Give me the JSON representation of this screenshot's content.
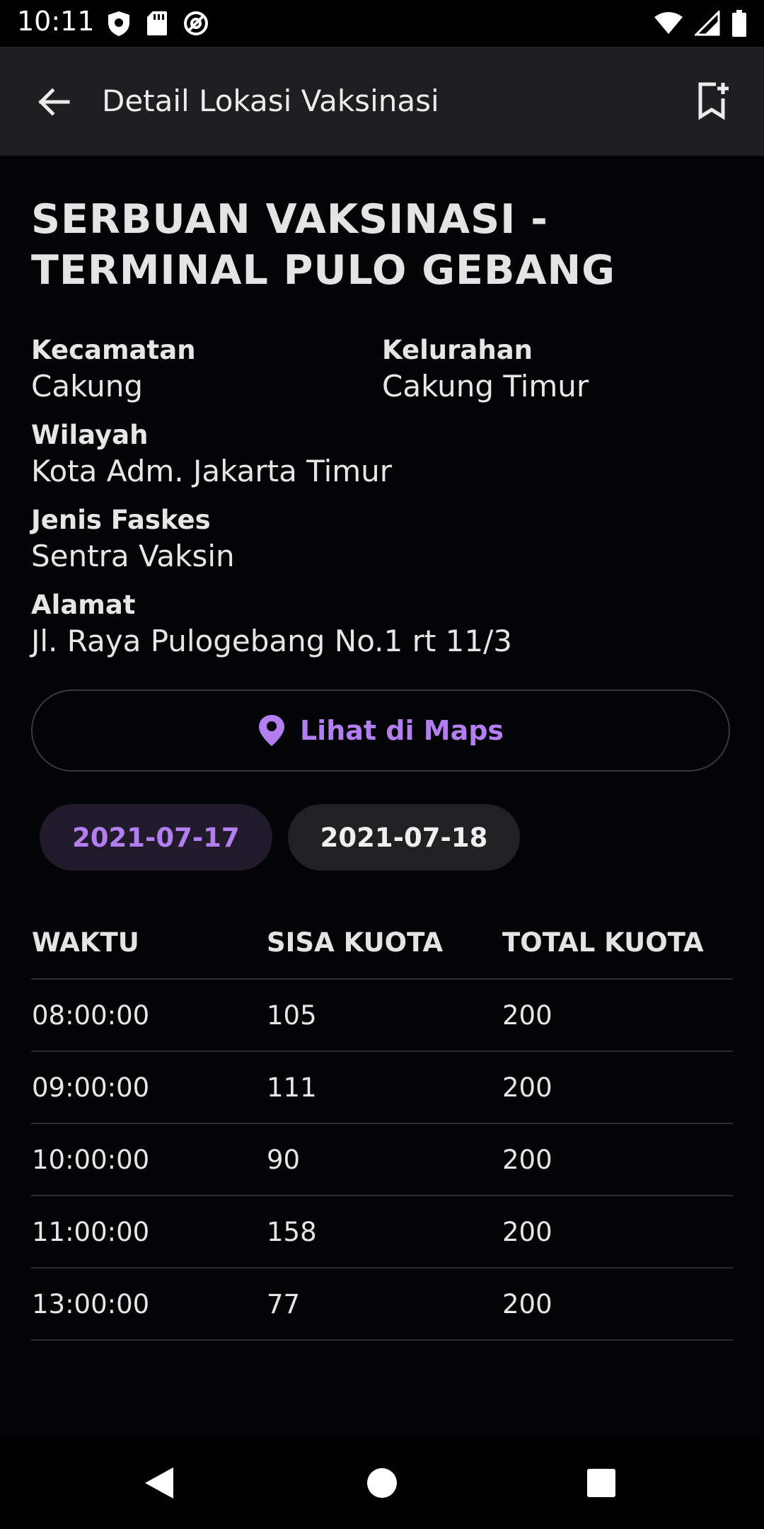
{
  "status_bar": {
    "time": "10:11",
    "left_icons": [
      "shield-icon",
      "sd-card-icon",
      "at-sign-icon"
    ],
    "right_icons": [
      "wifi-icon",
      "signal-icon",
      "battery-icon"
    ]
  },
  "app_bar": {
    "title": "Detail Lokasi Vaksinasi",
    "back_icon": "arrow-back-icon",
    "bookmark_icon": "bookmark-add-icon"
  },
  "location": {
    "name": "SERBUAN VAKSINASI - TERMINAL PULO GEBANG",
    "kecamatan_label": "Kecamatan",
    "kecamatan": "Cakung",
    "kelurahan_label": "Kelurahan",
    "kelurahan": "Cakung Timur",
    "wilayah_label": "Wilayah",
    "wilayah": "Kota Adm. Jakarta Timur",
    "faskes_label": "Jenis Faskes",
    "faskes": "Sentra Vaksin",
    "alamat_label": "Alamat",
    "alamat": "Jl. Raya Pulogebang No.1 rt 11/3"
  },
  "maps_button": {
    "label": "Lihat di Maps",
    "icon": "location-pin-icon"
  },
  "dates": [
    "2021-07-17",
    "2021-07-18"
  ],
  "selected_date": "2021-07-17",
  "colors": {
    "accent": "#b37ff0",
    "background": "#030405",
    "appbar": "#1d1f20"
  },
  "schedule": {
    "headers": [
      "WAKTU",
      "SISA KUOTA",
      "TOTAL KUOTA"
    ],
    "rows": [
      [
        "08:00:00",
        "105",
        "200"
      ],
      [
        "09:00:00",
        "111",
        "200"
      ],
      [
        "10:00:00",
        "90",
        "200"
      ],
      [
        "11:00:00",
        "158",
        "200"
      ],
      [
        "13:00:00",
        "77",
        "200"
      ]
    ]
  },
  "nav_bar": {
    "icons": [
      "back-triangle-icon",
      "home-circle-icon",
      "recents-square-icon"
    ]
  }
}
